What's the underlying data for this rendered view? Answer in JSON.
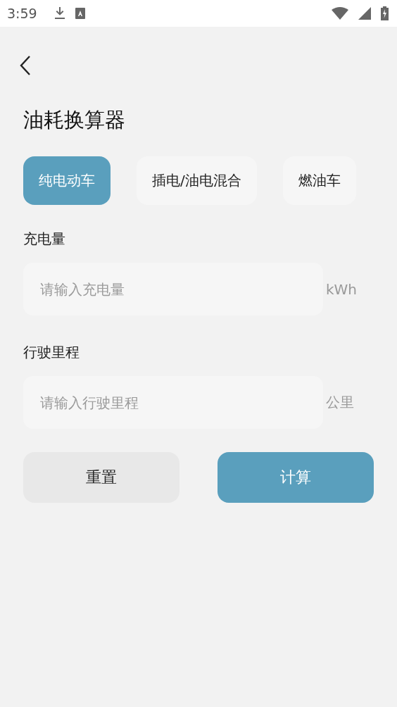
{
  "status_bar": {
    "time": "3:59"
  },
  "title": "油耗换算器",
  "tabs": [
    {
      "label": "纯电动车",
      "selected": true
    },
    {
      "label": "插电/油电混合",
      "selected": false
    },
    {
      "label": "燃油车",
      "selected": false
    }
  ],
  "fields": [
    {
      "label": "充电量",
      "placeholder": "请输入充电量",
      "unit": "kWh"
    },
    {
      "label": "行驶里程",
      "placeholder": "请输入行驶里程",
      "unit": "公里"
    }
  ],
  "buttons": [
    {
      "label": "重置",
      "kind": "secondary"
    },
    {
      "label": "计算",
      "kind": "primary"
    }
  ]
}
